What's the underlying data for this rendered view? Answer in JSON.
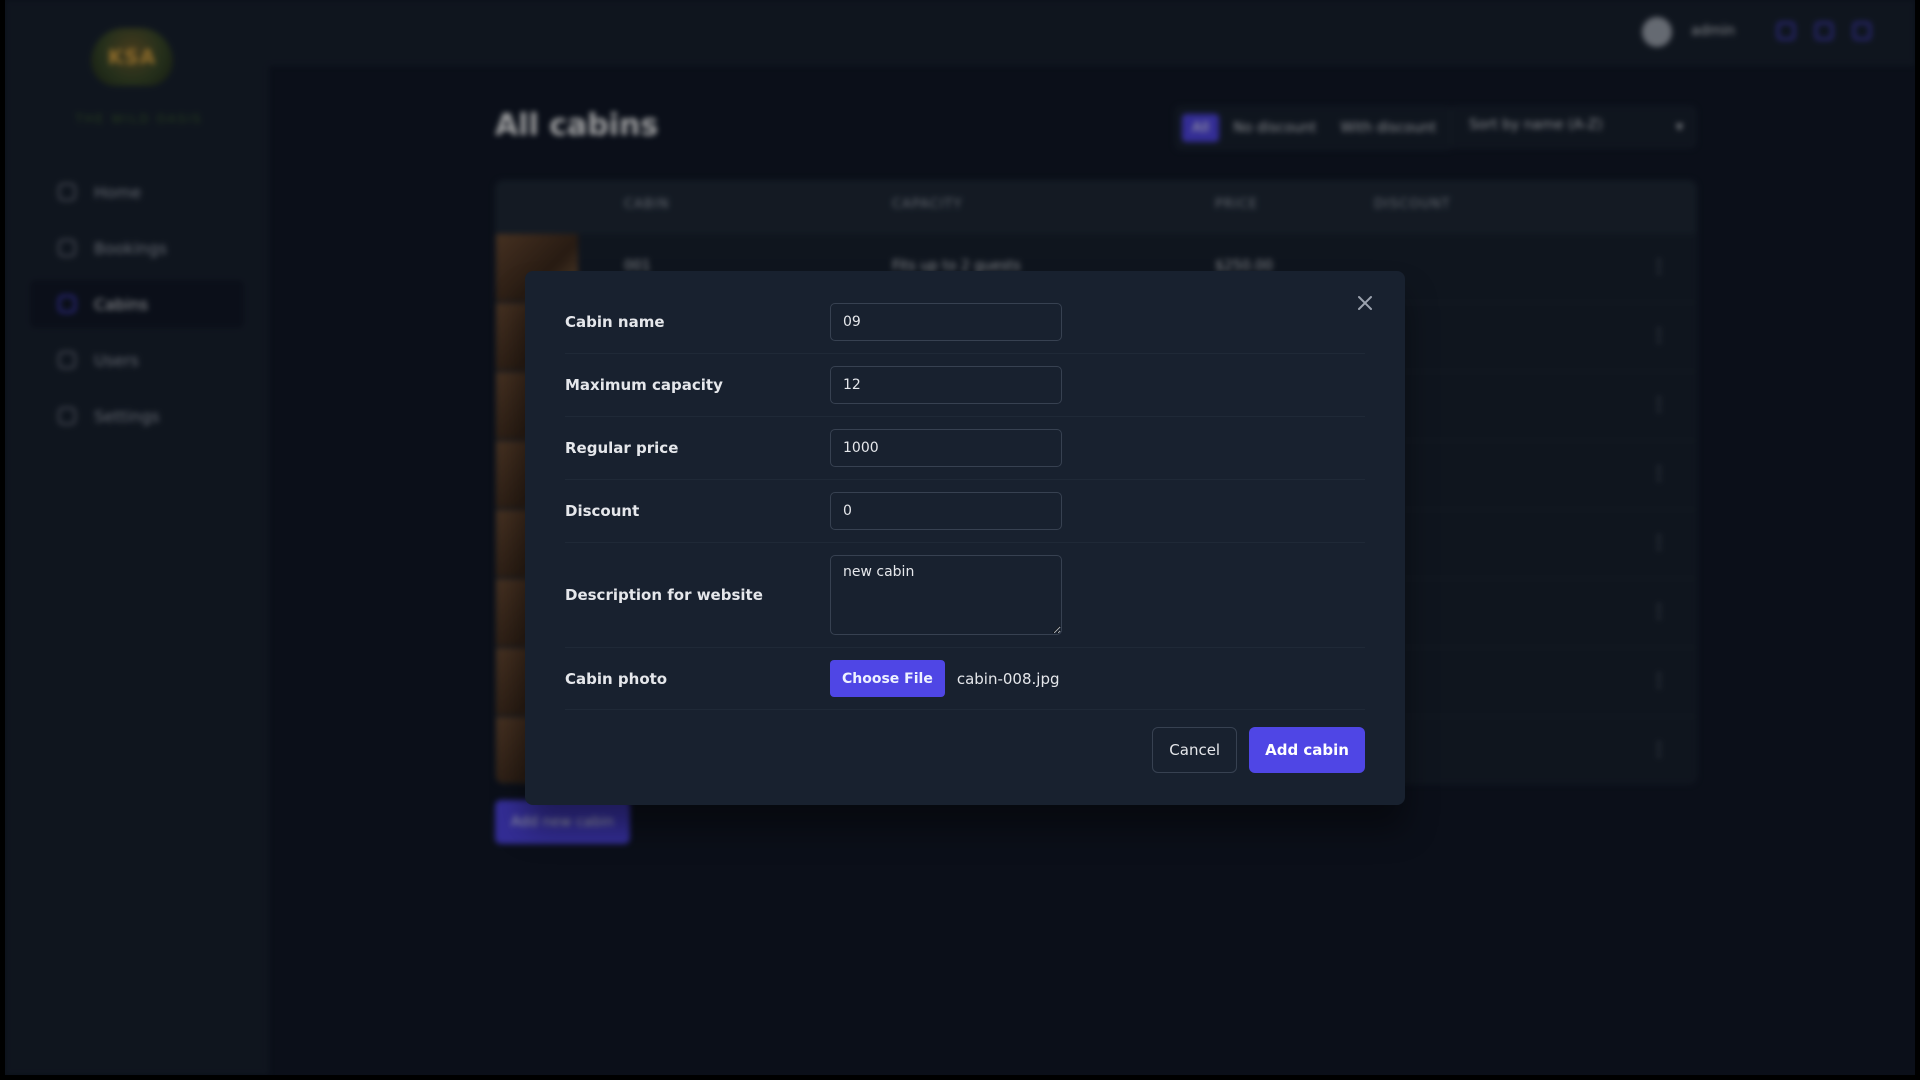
{
  "sidebar": {
    "logo_text": "KSA",
    "logo_caption": "THE WILD OASIS",
    "items": [
      {
        "label": "Home"
      },
      {
        "label": "Bookings"
      },
      {
        "label": "Cabins"
      },
      {
        "label": "Users"
      },
      {
        "label": "Settings"
      }
    ]
  },
  "header": {
    "user_name": "admin"
  },
  "page": {
    "title": "All cabins",
    "filters": [
      "All",
      "No discount",
      "With discount"
    ],
    "sort_value": "Sort by name (A-Z)",
    "table_headers": [
      "Cabin",
      "Capacity",
      "Price",
      "Discount"
    ],
    "row1": {
      "name": "001",
      "capacity": "Fits up to 2 guests",
      "price": "$250.00"
    },
    "add_new_label": "Add new cabin"
  },
  "modal": {
    "fields": {
      "name": {
        "label": "Cabin name",
        "value": "09"
      },
      "capacity": {
        "label": "Maximum capacity",
        "value": "12"
      },
      "price": {
        "label": "Regular price",
        "value": "1000"
      },
      "discount": {
        "label": "Discount",
        "value": "0"
      },
      "description": {
        "label": "Description for website",
        "value": "new cabin"
      },
      "photo": {
        "label": "Cabin photo",
        "button": "Choose File",
        "file_name": "cabin-008.jpg"
      }
    },
    "cancel_label": "Cancel",
    "submit_label": "Add cabin"
  },
  "colors": {
    "background": "#111827",
    "panel": "#18212f",
    "accent": "#4f46e5",
    "border": "#374151",
    "text": "#e5e7eb"
  },
  "icons": [
    "close-icon",
    "home-icon",
    "calendar-icon",
    "cabin-icon",
    "users-icon",
    "settings-icon",
    "chevron-down-icon",
    "more-icon"
  ]
}
